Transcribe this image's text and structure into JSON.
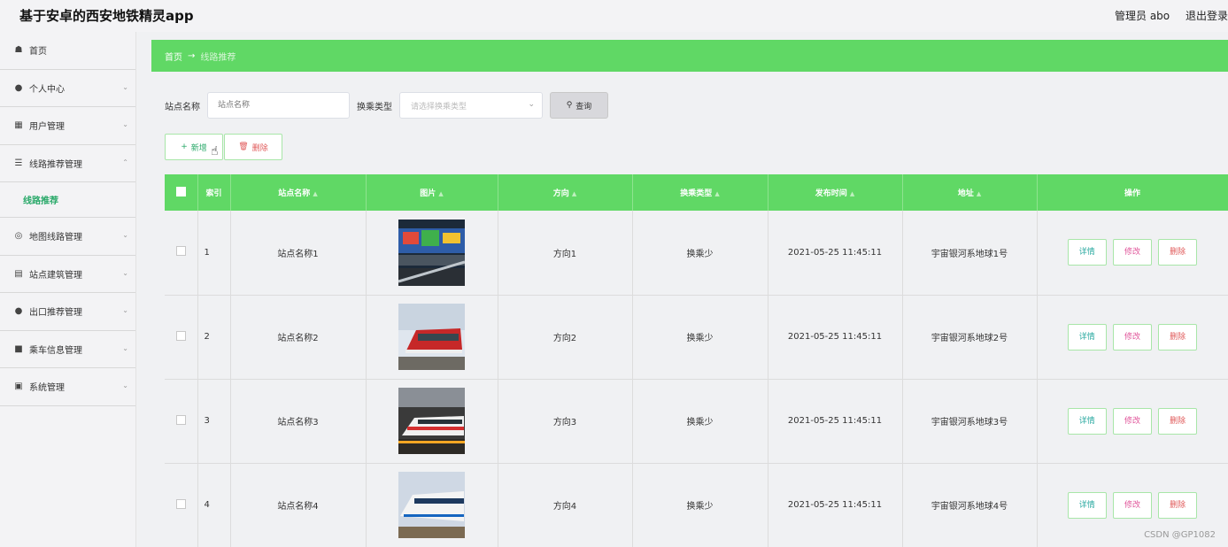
{
  "app": {
    "title": "基于安卓的西安地铁精灵app"
  },
  "header": {
    "user_label": "管理员 abo",
    "logout_label": "退出登录"
  },
  "sidebar": {
    "items": [
      {
        "label": "首页",
        "icon": "home-icon"
      },
      {
        "label": "个人中心",
        "icon": "person-icon"
      },
      {
        "label": "用户管理",
        "icon": "grid-icon"
      },
      {
        "label": "线路推荐管理",
        "icon": "list-icon"
      },
      {
        "label": "地图线路管理",
        "icon": "compass-icon"
      },
      {
        "label": "站点建筑管理",
        "icon": "building-icon"
      },
      {
        "label": "出口推荐管理",
        "icon": "person-icon"
      },
      {
        "label": "乘车信息管理",
        "icon": "chat-icon"
      },
      {
        "label": "系统管理",
        "icon": "monitor-icon"
      }
    ],
    "active_sub": "线路推荐"
  },
  "breadcrumb": {
    "home": "首页",
    "separator": "→",
    "current": "线路推荐"
  },
  "search": {
    "station_label": "站点名称",
    "station_placeholder": "站点名称",
    "transfer_label": "换乘类型",
    "transfer_placeholder": "请选择换乘类型",
    "query_label": "查询"
  },
  "actions": {
    "add_label": "新增",
    "delete_label": "删除"
  },
  "table": {
    "headers": [
      "索引",
      "站点名称",
      "图片",
      "方向",
      "换乘类型",
      "发布时间",
      "地址",
      "操作"
    ],
    "op_labels": {
      "detail": "详情",
      "edit": "修改",
      "delete": "删除"
    },
    "rows": [
      {
        "index": "1",
        "station": "站点名称1",
        "direction": "方向1",
        "transfer": "换乘少",
        "time": "2021-05-25 11:45:11",
        "address": "宇宙银河系地球1号"
      },
      {
        "index": "2",
        "station": "站点名称2",
        "direction": "方向2",
        "transfer": "换乘少",
        "time": "2021-05-25 11:45:11",
        "address": "宇宙银河系地球2号"
      },
      {
        "index": "3",
        "station": "站点名称3",
        "direction": "方向3",
        "transfer": "换乘少",
        "time": "2021-05-25 11:45:11",
        "address": "宇宙银河系地球3号"
      },
      {
        "index": "4",
        "station": "站点名称4",
        "direction": "方向4",
        "transfer": "换乘少",
        "time": "2021-05-25 11:45:11",
        "address": "宇宙银河系地球4号"
      }
    ]
  },
  "watermark": "CSDN @GP1082",
  "colors": {
    "accent": "#60d865",
    "active_menu": "#2aa96a"
  }
}
